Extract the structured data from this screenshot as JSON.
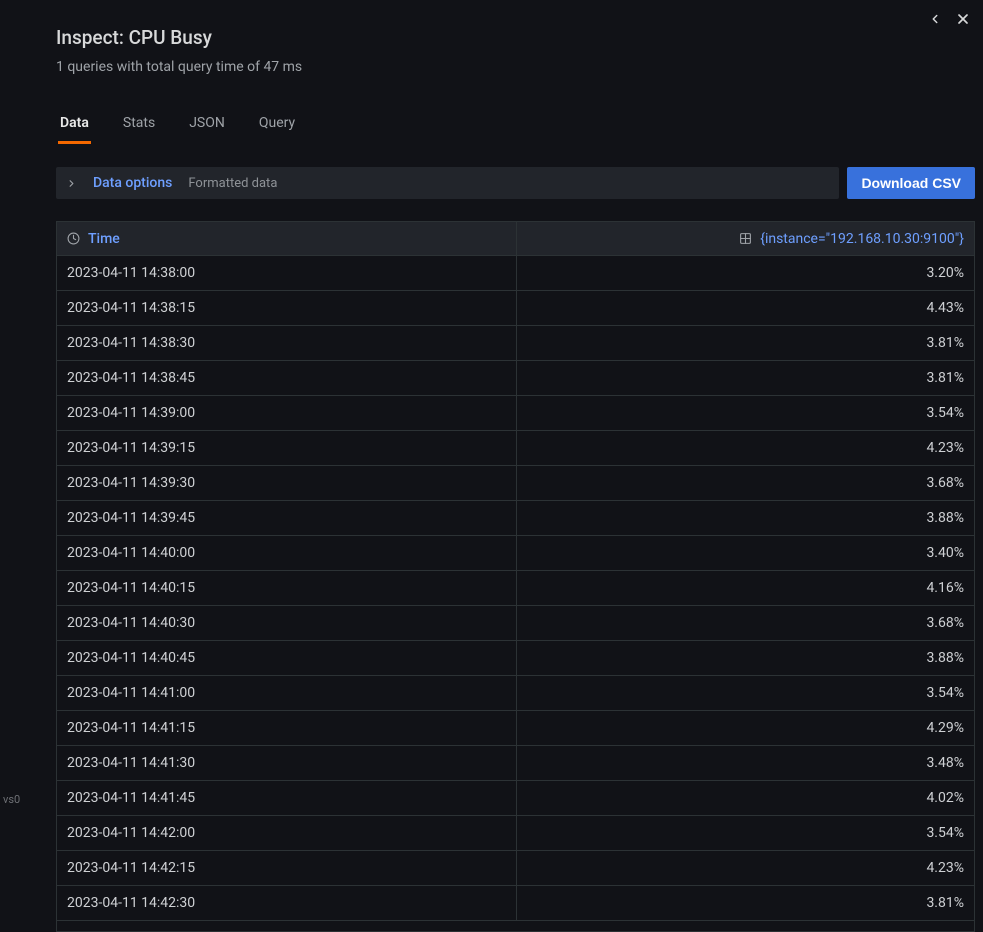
{
  "backdrop": {
    "label": "vs0"
  },
  "header": {
    "title": "Inspect: CPU Busy",
    "subtitle": "1 queries with total query time of 47 ms"
  },
  "tabs": [
    {
      "label": "Data",
      "active": true
    },
    {
      "label": "Stats",
      "active": false
    },
    {
      "label": "JSON",
      "active": false
    },
    {
      "label": "Query",
      "active": false
    }
  ],
  "options": {
    "label": "Data options",
    "hint": "Formatted data",
    "download_label": "Download CSV"
  },
  "table": {
    "time_header": "Time",
    "value_header": "{instance=\"192.168.10.30:9100\"}",
    "rows": [
      {
        "time": "2023-04-11 14:38:00",
        "value": "3.20%"
      },
      {
        "time": "2023-04-11 14:38:15",
        "value": "4.43%"
      },
      {
        "time": "2023-04-11 14:38:30",
        "value": "3.81%"
      },
      {
        "time": "2023-04-11 14:38:45",
        "value": "3.81%"
      },
      {
        "time": "2023-04-11 14:39:00",
        "value": "3.54%"
      },
      {
        "time": "2023-04-11 14:39:15",
        "value": "4.23%"
      },
      {
        "time": "2023-04-11 14:39:30",
        "value": "3.68%"
      },
      {
        "time": "2023-04-11 14:39:45",
        "value": "3.88%"
      },
      {
        "time": "2023-04-11 14:40:00",
        "value": "3.40%"
      },
      {
        "time": "2023-04-11 14:40:15",
        "value": "4.16%"
      },
      {
        "time": "2023-04-11 14:40:30",
        "value": "3.68%"
      },
      {
        "time": "2023-04-11 14:40:45",
        "value": "3.88%"
      },
      {
        "time": "2023-04-11 14:41:00",
        "value": "3.54%"
      },
      {
        "time": "2023-04-11 14:41:15",
        "value": "4.29%"
      },
      {
        "time": "2023-04-11 14:41:30",
        "value": "3.48%"
      },
      {
        "time": "2023-04-11 14:41:45",
        "value": "4.02%"
      },
      {
        "time": "2023-04-11 14:42:00",
        "value": "3.54%"
      },
      {
        "time": "2023-04-11 14:42:15",
        "value": "4.23%"
      },
      {
        "time": "2023-04-11 14:42:30",
        "value": "3.81%"
      }
    ]
  }
}
